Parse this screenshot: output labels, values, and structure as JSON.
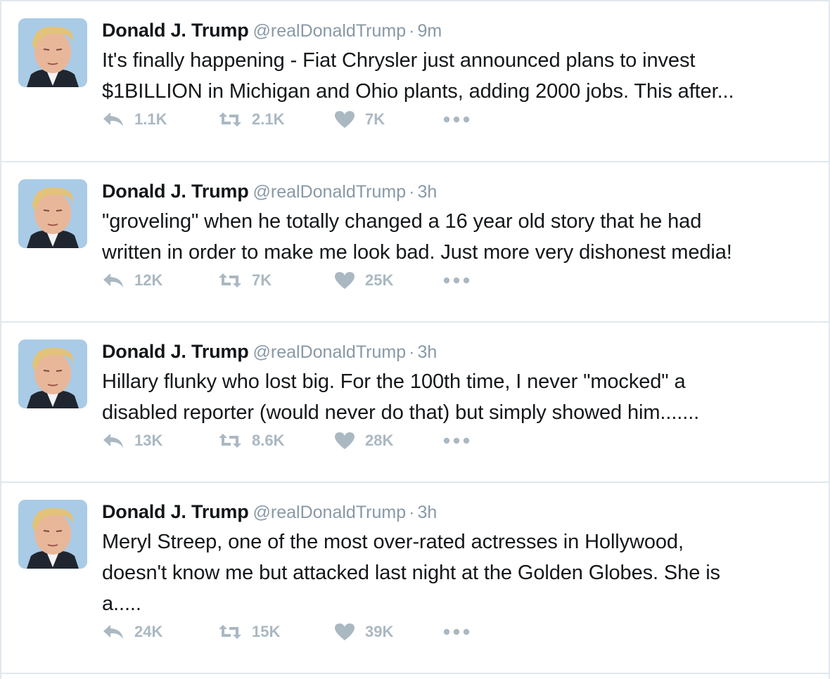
{
  "colors": {
    "text": "#14171a",
    "muted": "#8899a6",
    "icon": "#aab8c2",
    "divider": "#e1e8ed"
  },
  "icons": {
    "reply": "reply-icon",
    "retweet": "retweet-icon",
    "like": "heart-icon",
    "more": "more-dots-icon"
  },
  "tweets": [
    {
      "name": "Donald J. Trump",
      "handle": "@realDonaldTrump",
      "separator": "·",
      "time": "9m",
      "lines": [
        "It's finally happening - Fiat Chrysler just announced plans to invest",
        "$1BILLION in Michigan and Ohio plants, adding 2000 jobs. This after..."
      ],
      "replies": "1.1K",
      "retweets": "2.1K",
      "likes": "7K"
    },
    {
      "name": "Donald J. Trump",
      "handle": "@realDonaldTrump",
      "separator": "·",
      "time": "3h",
      "lines": [
        "\"groveling\" when he totally changed a 16 year old story that he had",
        "written in order to make me look bad. Just more very dishonest media!"
      ],
      "replies": "12K",
      "retweets": "7K",
      "likes": "25K"
    },
    {
      "name": "Donald J. Trump",
      "handle": "@realDonaldTrump",
      "separator": "·",
      "time": "3h",
      "lines": [
        "Hillary flunky who lost big. For the 100th time, I never \"mocked\" a",
        "disabled reporter (would never do that) but simply showed him......."
      ],
      "replies": "13K",
      "retweets": "8.6K",
      "likes": "28K"
    },
    {
      "name": "Donald J. Trump",
      "handle": "@realDonaldTrump",
      "separator": "·",
      "time": "3h",
      "lines": [
        "Meryl Streep, one of the most over-rated actresses in Hollywood,",
        "doesn't know me but attacked last night at the Golden Globes. She is",
        "a....."
      ],
      "replies": "24K",
      "retweets": "15K",
      "likes": "39K"
    }
  ]
}
